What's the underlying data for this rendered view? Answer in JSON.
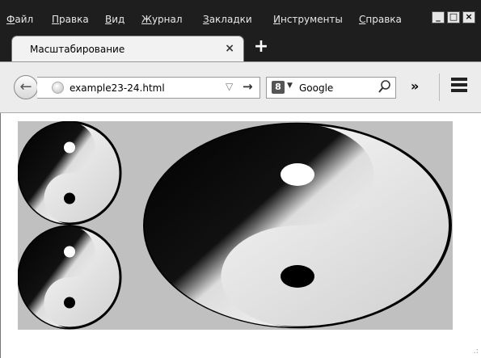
{
  "menu": {
    "items": [
      "Файл",
      "Правка",
      "Вид",
      "Журнал",
      "Закладки",
      "Инструменты",
      "Справка"
    ],
    "accelerators": [
      "Ф",
      "П",
      "В",
      "Ж",
      "З",
      "И",
      "С"
    ]
  },
  "window_controls": {
    "minimize": "_",
    "maximize": "□",
    "close": "×"
  },
  "tab": {
    "title": "Масштабирование",
    "close": "×",
    "new_tab": "+"
  },
  "navbar": {
    "back": "←",
    "url": "example23-24.html",
    "dropdown": "▽",
    "go": "→",
    "search_engine_icon": "8",
    "search_engine_dropdown": "▼",
    "search_placeholder": "Google",
    "search_icon": "⚲",
    "overflow": "»"
  },
  "canvas": {
    "background": "#c0c0c0",
    "symbols": [
      {
        "name": "yin-yang-small-top",
        "shape": "circle"
      },
      {
        "name": "yin-yang-small-bottom",
        "shape": "circle"
      },
      {
        "name": "yin-yang-large",
        "shape": "ellipse"
      }
    ]
  }
}
